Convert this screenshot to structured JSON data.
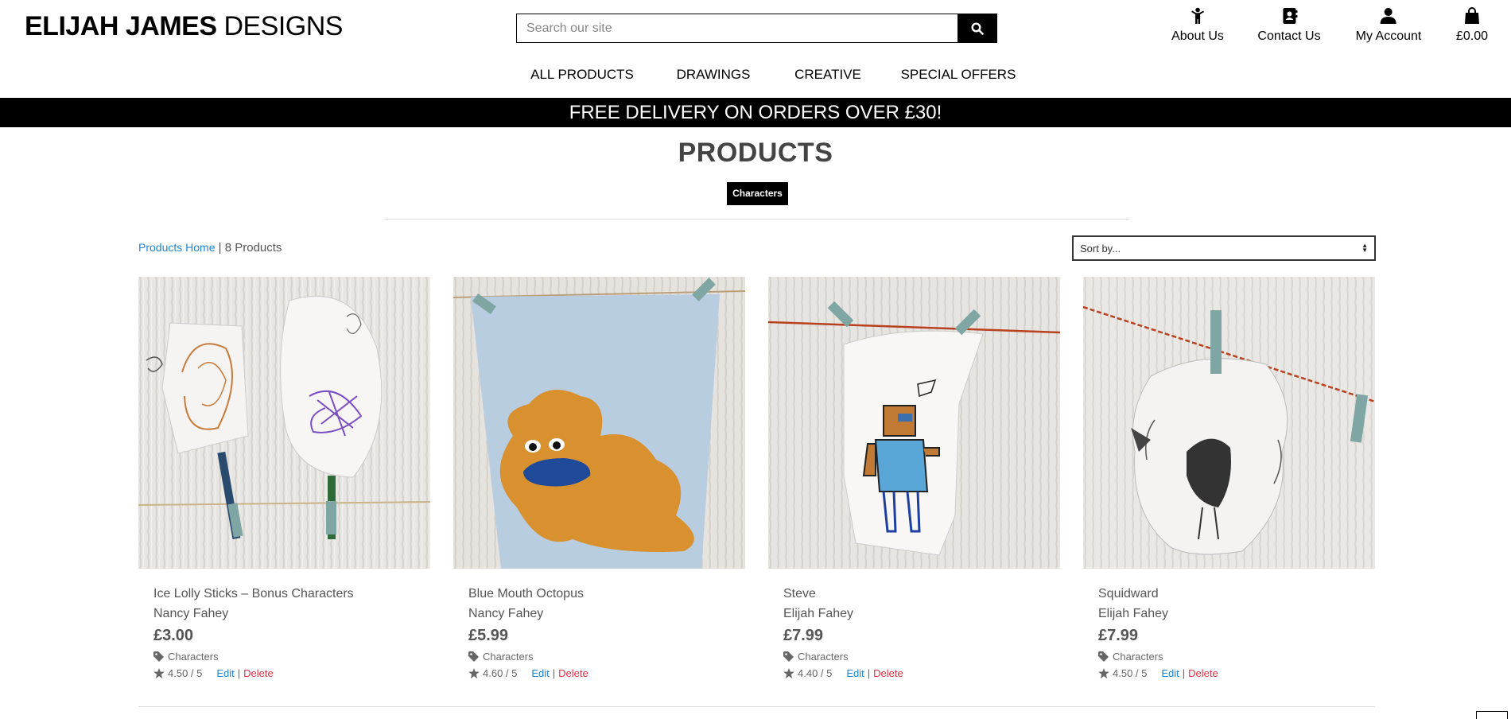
{
  "brand": {
    "bold": "ELIJAH JAMES",
    "light": "DESIGNS"
  },
  "search": {
    "placeholder": "Search our site",
    "icon": "search-icon"
  },
  "account_nav": [
    {
      "label": "About Us",
      "icon": "child-icon"
    },
    {
      "label": "Contact Us",
      "icon": "address-book-icon"
    },
    {
      "label": "My Account",
      "icon": "user-icon"
    },
    {
      "label": "£0.00",
      "icon": "shopping-bag-icon"
    }
  ],
  "main_nav": [
    "ALL PRODUCTS",
    "DRAWINGS",
    "CREATIVE",
    "SPECIAL OFFERS"
  ],
  "banner": "FREE DELIVERY ON ORDERS OVER £30!",
  "page": {
    "title": "PRODUCTS",
    "category_badge": "Characters",
    "crumb_link": "Products Home",
    "crumb_sep": " | ",
    "product_count": "8 Products",
    "sort_label": "Sort by..."
  },
  "products": [
    {
      "name": "Ice Lolly Sticks – Bonus Characters",
      "artist": "Nancy Fahey",
      "price": "£3.00",
      "category": "Characters",
      "rating": "4.50 / 5",
      "edit": "Edit",
      "delete": "Delete"
    },
    {
      "name": "Blue Mouth Octopus",
      "artist": "Nancy Fahey",
      "price": "£5.99",
      "category": "Characters",
      "rating": "4.60 / 5",
      "edit": "Edit",
      "delete": "Delete"
    },
    {
      "name": "Steve",
      "artist": "Elijah Fahey",
      "price": "£7.99",
      "category": "Characters",
      "rating": "4.40 / 5",
      "edit": "Edit",
      "delete": "Delete"
    },
    {
      "name": "Squidward",
      "artist": "Elijah Fahey",
      "price": "£7.99",
      "category": "Characters",
      "rating": "4.50 / 5",
      "edit": "Edit",
      "delete": "Delete"
    }
  ],
  "colors": {
    "link": "#1e86d6",
    "delete": "#dc3545",
    "banner_bg": "#000000"
  }
}
